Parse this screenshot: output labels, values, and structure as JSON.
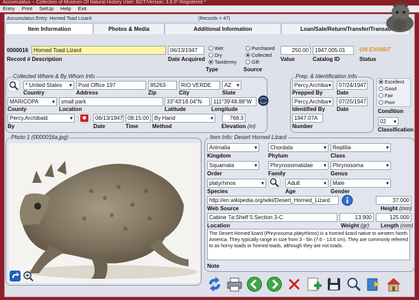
{
  "window": {
    "title": "Accumulatus -- Collection of Museum Of Natural History    User: BGT/Version: 3.8.0* Registered *"
  },
  "menu": [
    "Entry",
    "Print",
    "SetUp",
    "Help",
    "Exit"
  ],
  "subtitle": {
    "entry": "Accumulatus Entry: Horned Toad Lizard",
    "records": "(Records = 47)"
  },
  "tabs": [
    "Item Information",
    "Photos & Media",
    "Additional Information",
    "Loan/Sale/Return/Transfer/Transac"
  ],
  "record": {
    "number": "0000016",
    "description": "Horned Toad Lizard",
    "date_acquired": "06/13/1947",
    "type_options": [
      "Wet",
      "Dry",
      "Taxidermy"
    ],
    "type_selected": "Taxidermy",
    "source_options": [
      "Purchased",
      "Collected",
      "Gift"
    ],
    "source_selected": "Collected",
    "value": "250.00",
    "catalog_id": "1947.005.01",
    "status": "ON EXHIBIT"
  },
  "labels": {
    "record_desc": "Record # Description",
    "date_acquired": "Date Acquired",
    "type": "Type",
    "source": "Source",
    "value": "Value",
    "catalog_id": "Catalog ID",
    "status": "Status",
    "collected_where": "Collected Where & By Whom Info",
    "country": "Country",
    "address": "Address",
    "zip": "Zip",
    "city": "City",
    "state": "State",
    "county": "County",
    "location": "Location",
    "latitude": "Latitude",
    "longitude": "Longitude",
    "by": "By",
    "date": "Date",
    "time": "Time",
    "method": "Method",
    "elevation": "Elevation",
    "elevation_unit": "(m)",
    "prep_id": "Prep. & Identification Info",
    "prepped_by": "Prepped By",
    "prep_date": "Date",
    "identified_by": "Identified By",
    "id_date": "Date",
    "number": "Number",
    "condition": "Condition",
    "classification": "Classification",
    "photo": "Photo 1 (0000016a.jpg)",
    "item_info": "Item Info: Desert Horned Lizard",
    "kingdom": "Kingdom",
    "phylum": "Phylum",
    "class": "Class",
    "order": "Order",
    "family": "Family",
    "genus": "Genus",
    "species": "Species",
    "age": "Age",
    "gender": "Gender",
    "web_source": "Web Source",
    "height": "Height",
    "height_unit": "(mm)",
    "location2": "Location",
    "weight": "Weight",
    "weight_unit": "(gr)",
    "length": "Length",
    "length_unit": "(mm)",
    "note": "Note"
  },
  "collected": {
    "country": "* United States",
    "address": "Post Office 197",
    "zip": "85263-",
    "city": "RIO VERDE",
    "state": "AZ",
    "county": "MARICOPA",
    "location": "small park",
    "latitude": "33°43'18.04\"N",
    "longitude": "111°39'48.88\"W",
    "by": "Percy,Archibald",
    "date": "06/13/1947",
    "time": "08:15:00",
    "method": "By Hand",
    "elevation": "768.3"
  },
  "prep": {
    "prepped_by": "Percy,Archiba",
    "prep_date": "07/24/1947",
    "identified_by": "Percy,Archiba",
    "id_date": "07/25/1947",
    "number": "1947.07A"
  },
  "condition": {
    "options": [
      "Excellent",
      "Good",
      "Fair",
      "Poor"
    ],
    "selected": "Excellent",
    "classification": "02"
  },
  "taxonomy": {
    "kingdom": "Animalia",
    "phylum": "Chordata",
    "class": "Reptilia",
    "order": "Squamata",
    "family": "Phrynosomatidae",
    "genus": "Phrynosoma",
    "species": "platyrhinos",
    "age": "Adult",
    "gender": "Male",
    "web_source": "http://en.wikipedia.org/wiki/Desert_Horned_Lizard",
    "height": "37.000",
    "location": "Cabine 7a:Shelf 5:Section 3-C",
    "weight": "13.900",
    "length": "125.000",
    "note": "The Desert Horned lizard (Phrynosoma platyrhinos) is a horned lizard native to western North America. They typically range in size from 3 - 5in (7.6 - 13.6 cm). They are commonly referred to as horny toads or horned toads, although they are not toads."
  },
  "toolbar": [
    "refresh-icon",
    "print-icon",
    "back-icon",
    "forward-icon",
    "delete-icon",
    "add-icon",
    "save-icon",
    "search-icon",
    "export-icon",
    "home-icon"
  ]
}
